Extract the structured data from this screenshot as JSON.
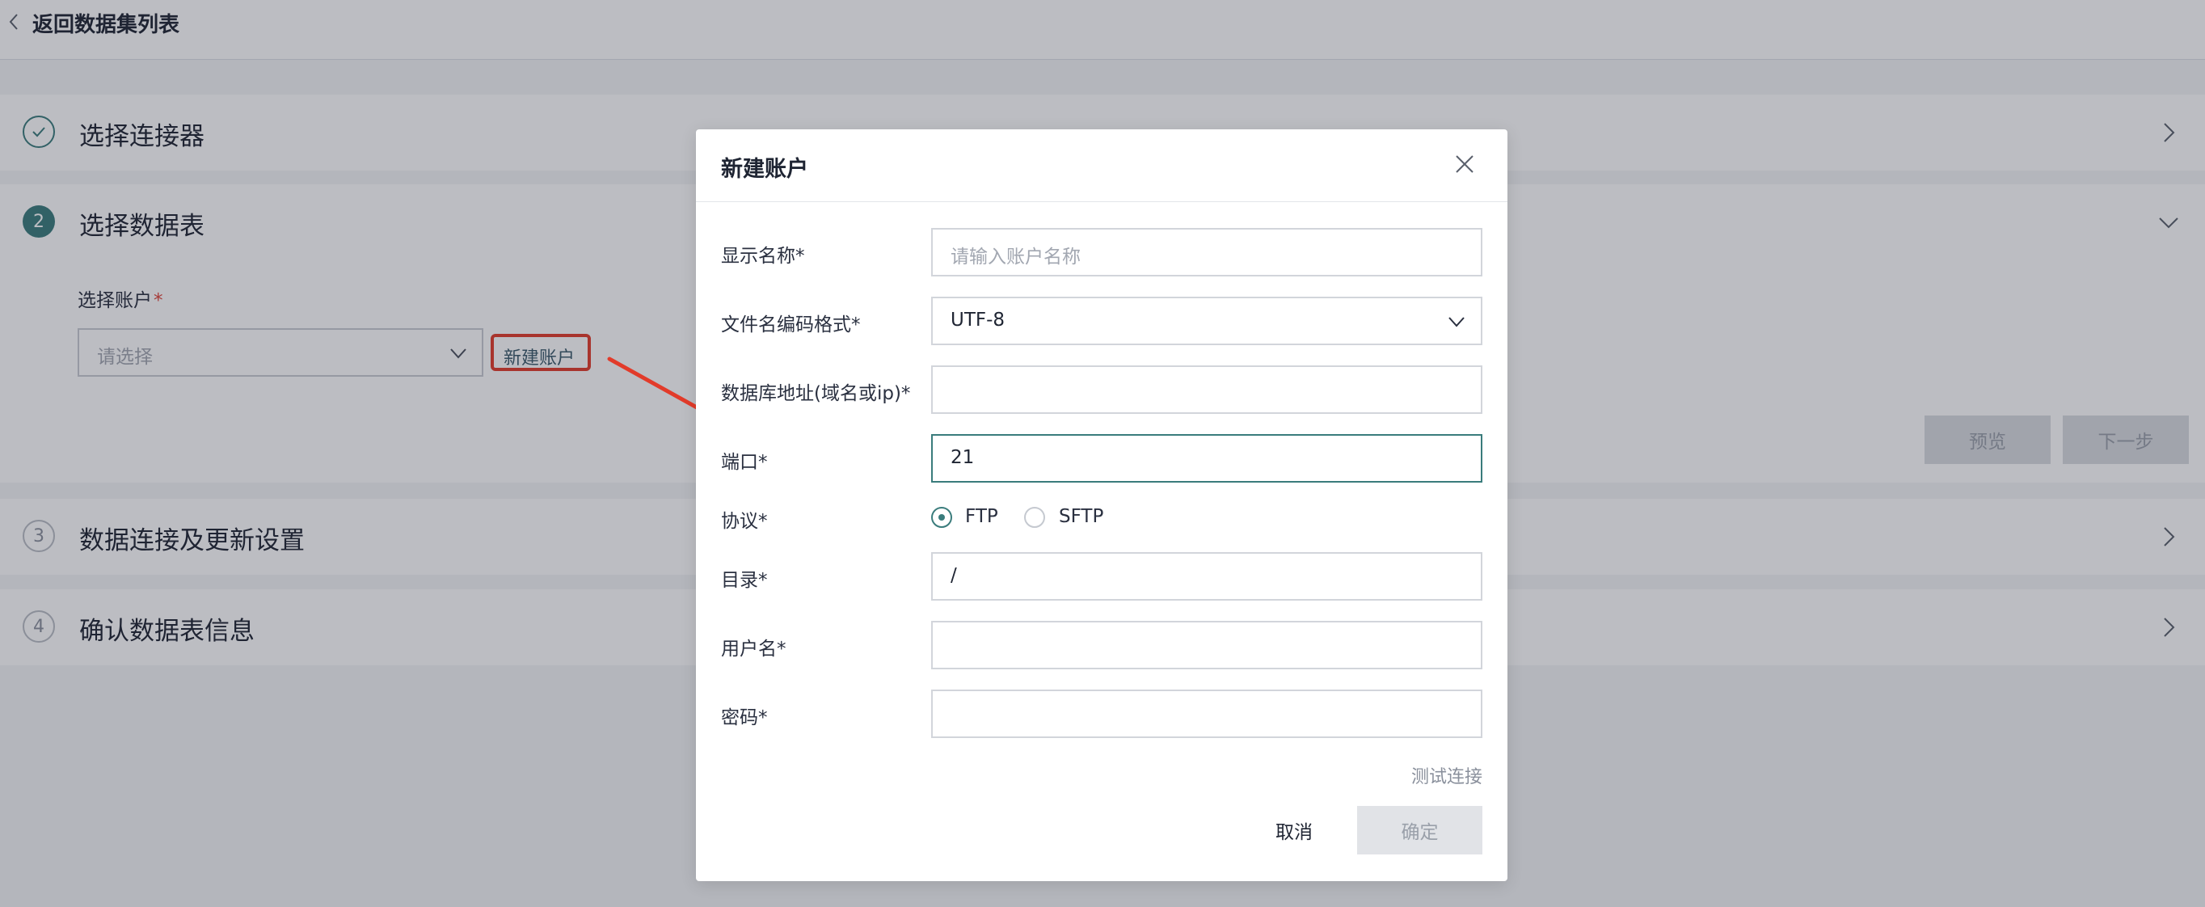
{
  "header": {
    "back_label": "返回数据集列表"
  },
  "steps": [
    {
      "number": "",
      "title": "选择连接器",
      "state": "done"
    },
    {
      "number": "2",
      "title": "选择数据表",
      "state": "active"
    },
    {
      "number": "3",
      "title": "数据连接及更新设置",
      "state": "todo"
    },
    {
      "number": "4",
      "title": "确认数据表信息",
      "state": "todo"
    }
  ],
  "step2": {
    "account_label": "选择账户",
    "required_mark": "*",
    "account_placeholder": "请选择",
    "new_account_button": "新建账户",
    "preview_button": "预览",
    "next_button": "下一步"
  },
  "modal": {
    "title": "新建账户",
    "fields": {
      "display_name": {
        "label": "显示名称*",
        "placeholder": "请输入账户名称",
        "value": ""
      },
      "encoding": {
        "label": "文件名编码格式*",
        "value": "UTF-8"
      },
      "host": {
        "label": "数据库地址(域名或ip)*",
        "value": ""
      },
      "port": {
        "label": "端口*",
        "value": "21"
      },
      "protocol": {
        "label": "协议*",
        "options": [
          "FTP",
          "SFTP"
        ],
        "selected": "FTP"
      },
      "directory": {
        "label": "目录*",
        "value": "/"
      },
      "username": {
        "label": "用户名*",
        "value": ""
      },
      "password": {
        "label": "密码*",
        "value": ""
      }
    },
    "test_connection": "测试连接",
    "cancel_button": "取消",
    "confirm_button": "确定"
  },
  "colors": {
    "accent": "#3a7c7c",
    "highlight_red": "#e23b2a"
  }
}
